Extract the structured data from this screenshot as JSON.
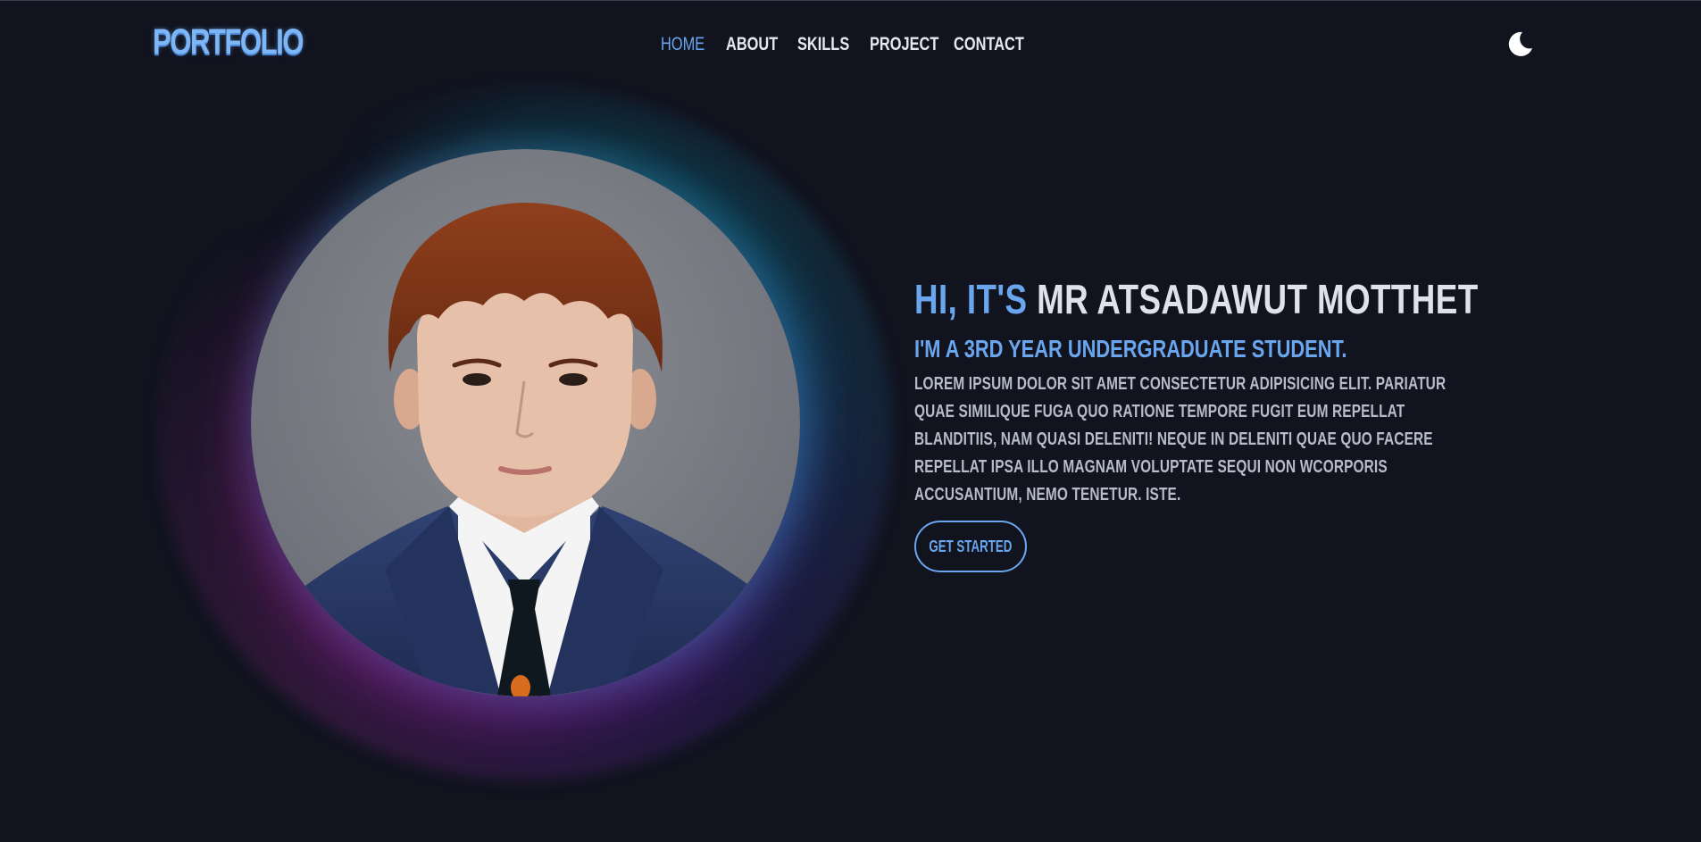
{
  "header": {
    "logo": "PORTFOLIO",
    "nav": [
      {
        "label": "HOME",
        "active": true
      },
      {
        "label": "ABOUT",
        "active": false
      },
      {
        "label": "SKILLS",
        "active": false
      },
      {
        "label": "PROJECT",
        "active": false
      },
      {
        "label": "CONTACT",
        "active": false
      }
    ],
    "theme_icon": "moon-icon"
  },
  "hero": {
    "greeting_prefix": "HI, IT'S",
    "name": "MR ATSADAWUT MOTTHET",
    "subtitle": "I'M A 3RD YEAR UNDERGRADUATE STUDENT.",
    "description": "LOREM IPSUM DOLOR SIT AMET CONSECTETUR ADIPISICING ELIT. PARIATUR QUAE SIMILIQUE FUGA QUO RATIONE TEMPORE FUGIT EUM REPELLAT BLANDITIIS, NAM QUASI DELENITI! NEQUE IN DELENITI QUAE QUO FACERE REPELLAT IPSA ILLO MAGNAM VOLUPTATE SEQUI NON WCORPORIS ACCUSANTIUM, NEMO TENETUR. ISTE.",
    "cta_label": "GET STARTED",
    "avatar_icon": "profile-photo"
  },
  "colors": {
    "background": "#11131f",
    "accent": "#6aa6ee",
    "text": "#dfe2ea",
    "muted": "#b7bcc8"
  }
}
